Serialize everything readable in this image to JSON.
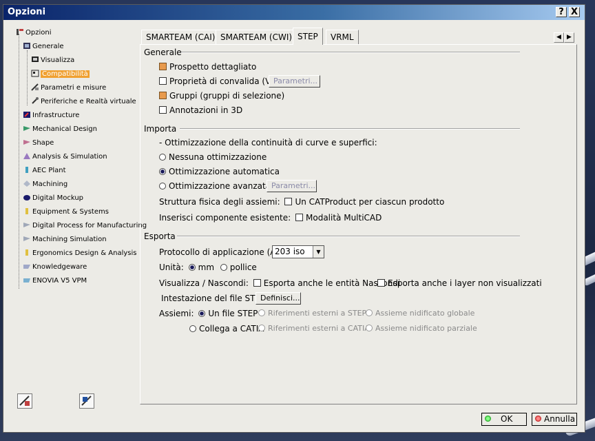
{
  "window": {
    "title": "Opzioni",
    "help_label": "?",
    "close_label": "X"
  },
  "tree": {
    "root": "Opzioni",
    "items": [
      {
        "label": "Generale",
        "icon": "general-icon"
      },
      {
        "label": "Visualizza",
        "icon": "display-icon"
      },
      {
        "label": "Compatibilità",
        "icon": "compatibility-icon",
        "selected": true
      },
      {
        "label": "Parametri e misure",
        "icon": "parameters-icon"
      },
      {
        "label": "Periferiche e Realtà virtuale",
        "icon": "devices-icon"
      },
      {
        "label": "Infrastructure",
        "icon": "infrastructure-icon"
      },
      {
        "label": "Mechanical Design",
        "icon": "mechanical-design-icon"
      },
      {
        "label": "Shape",
        "icon": "shape-icon"
      },
      {
        "label": "Analysis & Simulation",
        "icon": "analysis-icon"
      },
      {
        "label": "AEC Plant",
        "icon": "aec-plant-icon"
      },
      {
        "label": "Machining",
        "icon": "machining-icon"
      },
      {
        "label": "Digital Mockup",
        "icon": "digital-mockup-icon"
      },
      {
        "label": "Equipment & Systems",
        "icon": "equipment-icon"
      },
      {
        "label": "Digital Process for Manufacturing",
        "icon": "digital-process-icon"
      },
      {
        "label": "Machining Simulation",
        "icon": "machining-simulation-icon"
      },
      {
        "label": "Ergonomics Design & Analysis",
        "icon": "ergonomics-icon"
      },
      {
        "label": "Knowledgeware",
        "icon": "knowledgeware-icon"
      },
      {
        "label": "ENOVIA V5 VPM",
        "icon": "enovia-icon"
      }
    ]
  },
  "tabs": [
    {
      "label": "SMARTEAM (CAI)"
    },
    {
      "label": "SMARTEAM (CWI)"
    },
    {
      "label": "STEP",
      "active": true
    },
    {
      "label": "VRML"
    }
  ],
  "generale": {
    "title": "Generale",
    "prospetto": {
      "label": "Prospetto dettagliato",
      "checked": true
    },
    "proprieta": {
      "label": "Proprietà di convalida (VP)",
      "checked": false,
      "button": "Parametri..."
    },
    "gruppi": {
      "label": "Gruppi (gruppi di selezione)",
      "checked": true
    },
    "annotazioni": {
      "label": "Annotazioni in 3D",
      "checked": false
    }
  },
  "importa": {
    "title": "Importa",
    "ottimizzazione_label": "- Ottimizzazione della continuità di curve e superfici:",
    "opt_none": "Nessuna ottimizzazione",
    "opt_auto": "Ottimizzazione automatica",
    "opt_adv": "Ottimizzazione avanzata",
    "opt_adv_button": "Parametri...",
    "selected_option": "Ottimizzazione automatica",
    "struttura_label": "Struttura fisica degli assiemi:",
    "struttura_check": "Un CATProduct per ciascun prodotto",
    "inserisci_label": "Inserisci componente esistente:",
    "inserisci_check": "Modalità MultiCAD"
  },
  "esporta": {
    "title": "Esporta",
    "protocollo_label": "Protocollo di applicazione (AP) :",
    "protocollo_value": "203 iso",
    "unita_label": "Unità:",
    "unita_mm": "mm",
    "unita_pollice": "pollice",
    "visualizza_label": "Visualizza / Nascondi:",
    "esporta_nascondi": "Esporta anche le entità Nascondi",
    "esporta_layer": "Esporta anche i layer non visualizzati",
    "intestazione_label": "Intestazione del file STEP:",
    "definisci_button": "Definisci...",
    "assiemi_label": "Assiemi:",
    "un_file": "Un file STEP",
    "collega": "Collega a CATIA",
    "rif_esterni_step": "Riferimenti esterni a STEP",
    "rif_esterni_catia": "Riferimenti esterni a CATIA",
    "assieme_globale": "Assieme nidificato globale",
    "assieme_parziale": "Assieme nidificato parziale"
  },
  "footer": {
    "ok": "OK",
    "annulla": "Annulla"
  },
  "colors": {
    "title_start": "#0a246a",
    "title_end": "#a6caf0",
    "selection": "#f0a030",
    "checkbox_on": "#e89a4c"
  }
}
